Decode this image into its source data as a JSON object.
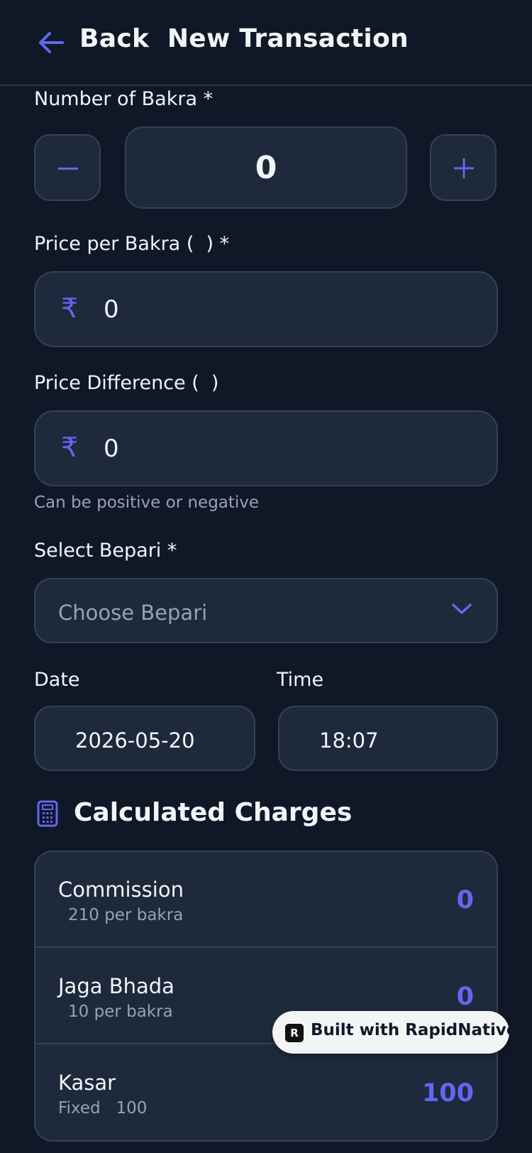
{
  "header": {
    "back_icon": "arrow-left-icon",
    "title": "Back  New Transaction"
  },
  "bakra": {
    "label": "Number of Bakra *",
    "minus": "−",
    "value": "0",
    "plus": "+"
  },
  "price_per_bakra": {
    "label": "Price per Bakra (  ) *",
    "currency_icon": "₹",
    "value": "0"
  },
  "price_difference": {
    "label": "Price Difference (  )",
    "currency_icon": "₹",
    "value": "0",
    "hint": "Can be positive or negative"
  },
  "bepari": {
    "label": "Select Bepari *",
    "placeholder": "Choose Bepari",
    "chevron_icon": "chevron-down-icon"
  },
  "date": {
    "label": "Date",
    "value": "2026-05-20"
  },
  "time": {
    "label": "Time",
    "value": "18:07"
  },
  "charges": {
    "icon": "calculator-icon",
    "title": "Calculated Charges",
    "rows": [
      {
        "title": "Commission",
        "sub": "210 per bakra",
        "value": "0"
      },
      {
        "title": "Jaga Bhada",
        "sub": "10 per bakra",
        "value": "0"
      },
      {
        "title": "Kasar",
        "sub": "Fixed   100",
        "value": "100"
      }
    ]
  },
  "badge": {
    "logo": "R",
    "text": "Built with RapidNative"
  },
  "colors": {
    "background": "#101828",
    "card": "#1e293b",
    "border": "#344155",
    "accent": "#6366f1",
    "muted": "#94a3b8"
  }
}
